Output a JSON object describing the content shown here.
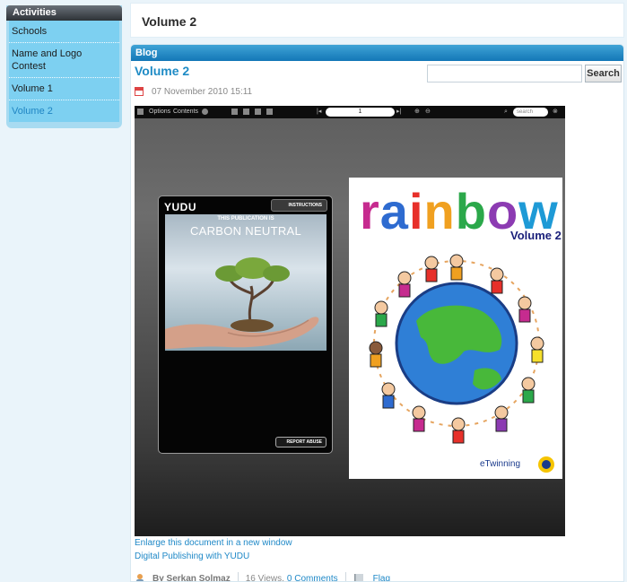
{
  "sidebar": {
    "title": "Activities",
    "items": [
      {
        "label": "Schools"
      },
      {
        "label": "Name and Logo Contest"
      },
      {
        "label": "Volume 1"
      },
      {
        "label": "Volume 2"
      }
    ]
  },
  "header": {
    "title": "Volume 2"
  },
  "blog": {
    "bar_title": "Blog",
    "post_title": "Volume 2",
    "date": "07 November 2010 15:11",
    "search": {
      "placeholder": "",
      "button": "Search"
    }
  },
  "viewer": {
    "toolbar": {
      "options": "Options",
      "contents": "Contents",
      "page": "1",
      "search_placeholder": "search"
    },
    "yudu": {
      "logo": "YUDU",
      "instructions": "INSTRUCTIONS",
      "carbon_small": "THIS PUBLICATION IS",
      "carbon_big": "CARBON NEUTRAL",
      "report": "REPORT ABUSE"
    },
    "cover": {
      "title_letters": [
        "r",
        "a",
        "i",
        "n",
        "b",
        "o",
        "w"
      ],
      "title_colors": [
        "#c62b8f",
        "#2e6bd0",
        "#e7302a",
        "#f0a020",
        "#2ba84a",
        "#8c3bb2",
        "#1e9ad6"
      ],
      "volume": "Volume 2",
      "logo_text": "eTwinning"
    }
  },
  "links": {
    "enlarge": "Enlarge this document in a new window",
    "digital": "Digital Publishing with YUDU"
  },
  "footer": {
    "author": "By Serkan Solmaz",
    "views": "16 Views,",
    "comments": "0 Comments",
    "flag": "Flag"
  },
  "colors": {
    "accent": "#1e8bc5",
    "sidebar": "#7dd0f1"
  }
}
